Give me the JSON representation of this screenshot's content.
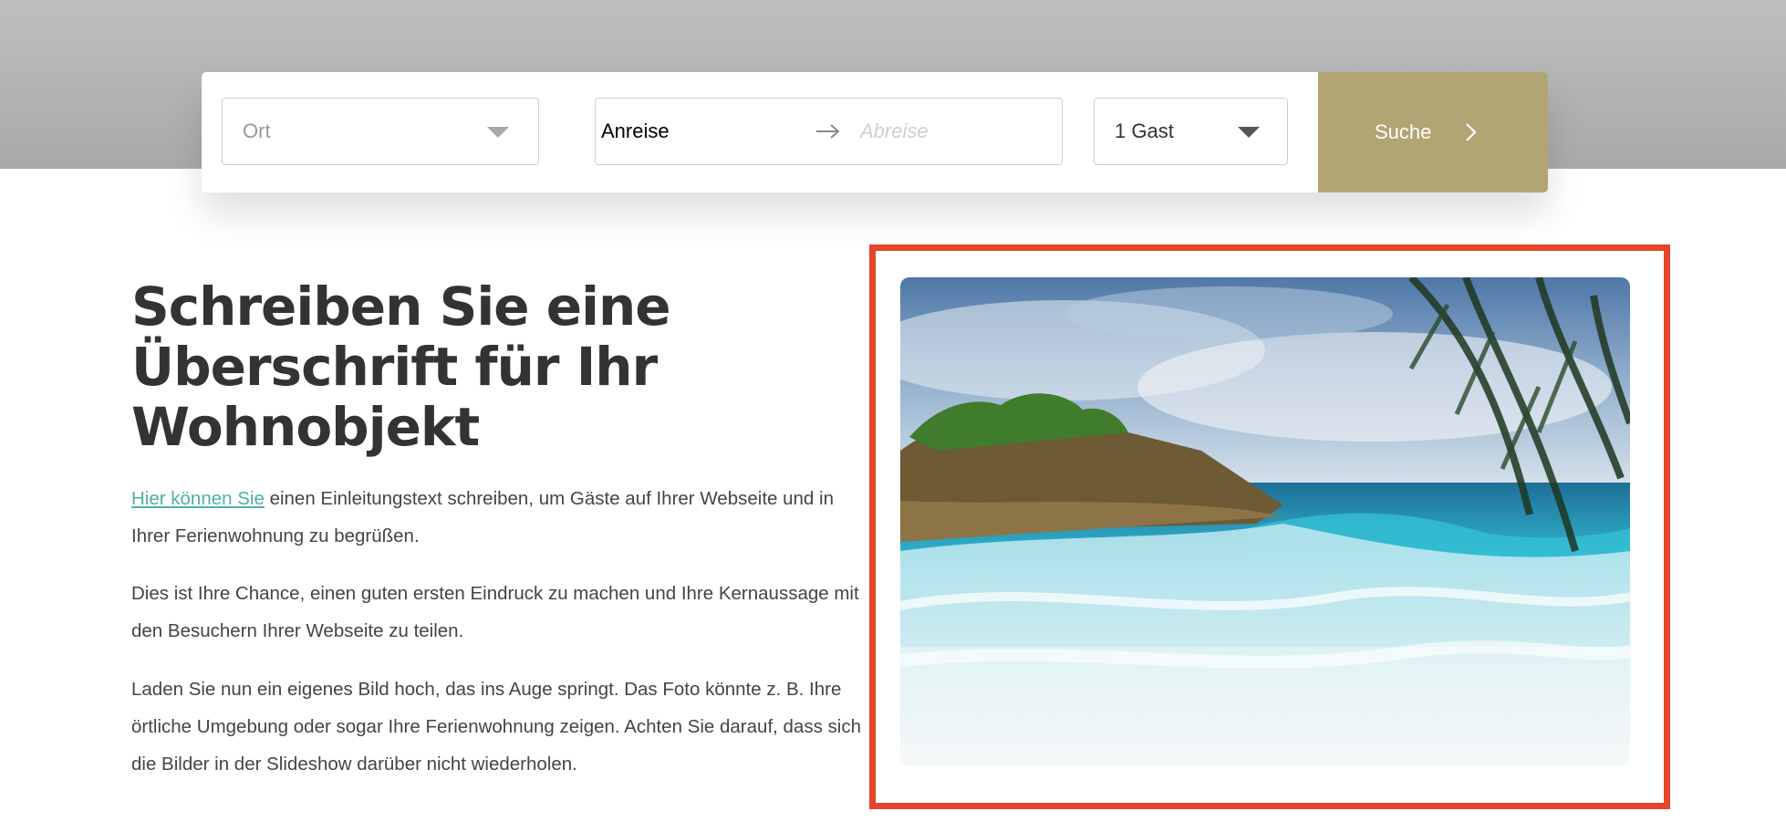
{
  "search": {
    "location_placeholder": "Ort",
    "arrival_placeholder": "Anreise",
    "departure_placeholder": "Abreise",
    "guests_value": "1 Gast",
    "button_label": "Suche"
  },
  "content": {
    "headline": "Schreiben Sie eine Überschrift für Ihr Wohnobjekt",
    "intro_link": "Hier können Sie",
    "intro_rest": " einen Einleitungstext schreiben, um Gäste auf Ihrer Webseite und in Ihrer Ferienwohnung zu begrüßen.",
    "paragraph_2": "Dies ist Ihre Chance, einen guten ersten Eindruck zu machen und Ihre Kernaussage mit den Besuchern Ihrer Webseite zu teilen.",
    "paragraph_3": "Laden Sie nun ein eigenes Bild hoch, das ins Auge springt. Das Foto könnte z. B. Ihre örtliche Umgebung oder sogar Ihre Ferienwohnung zeigen. Achten Sie darauf, dass sich die Bilder in der Slideshow darüber nicht wiederholen."
  },
  "colors": {
    "accent_button": "#b2a574",
    "link": "#4fb0a5",
    "highlight_border": "#e5452b",
    "heading": "#333333"
  },
  "icons": {
    "location_dropdown": "chevron-down-icon",
    "date_separator": "arrow-right-icon",
    "guests_dropdown": "chevron-down-icon",
    "search_button": "chevron-right-icon"
  }
}
